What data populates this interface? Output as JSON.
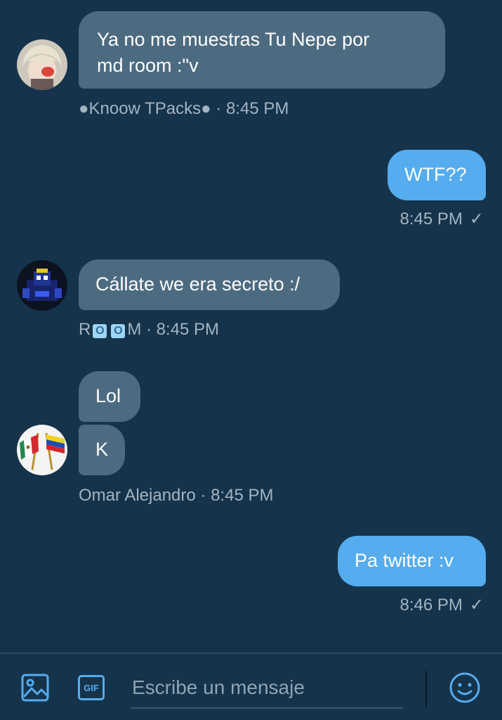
{
  "messages": [
    {
      "text_line1": "Ya no me muestras Tu Nepe por",
      "text_line2": "md room :\"v",
      "sender": "●Knoow TPacks●",
      "time": "8:45 PM"
    },
    {
      "text": "WTF??",
      "time": "8:45 PM",
      "check": "✓"
    },
    {
      "text": "Cállate we era secreto :/",
      "sender_prefix": "R",
      "sender_sq1": "O",
      "sender_sq2": "O",
      "sender_suffix": "M",
      "time": "8:45 PM"
    },
    {
      "text": "Lol"
    },
    {
      "text": "K",
      "sender": "Omar Alejandro",
      "time": "8:45 PM"
    },
    {
      "text": "Pa twitter :v",
      "time": "8:46 PM",
      "check": "✓"
    }
  ],
  "meta_separator": " · ",
  "composer": {
    "placeholder": "Escribe un mensaje",
    "gif_label": "GIF",
    "icons": [
      "image-icon",
      "gif-icon",
      "emoji-icon"
    ]
  },
  "colors": {
    "background": "#15334b",
    "incoming_bubble": "#4d6b80",
    "outgoing_bubble": "#55acee",
    "meta_text": "#a3b4c1",
    "accent": "#55acee"
  }
}
